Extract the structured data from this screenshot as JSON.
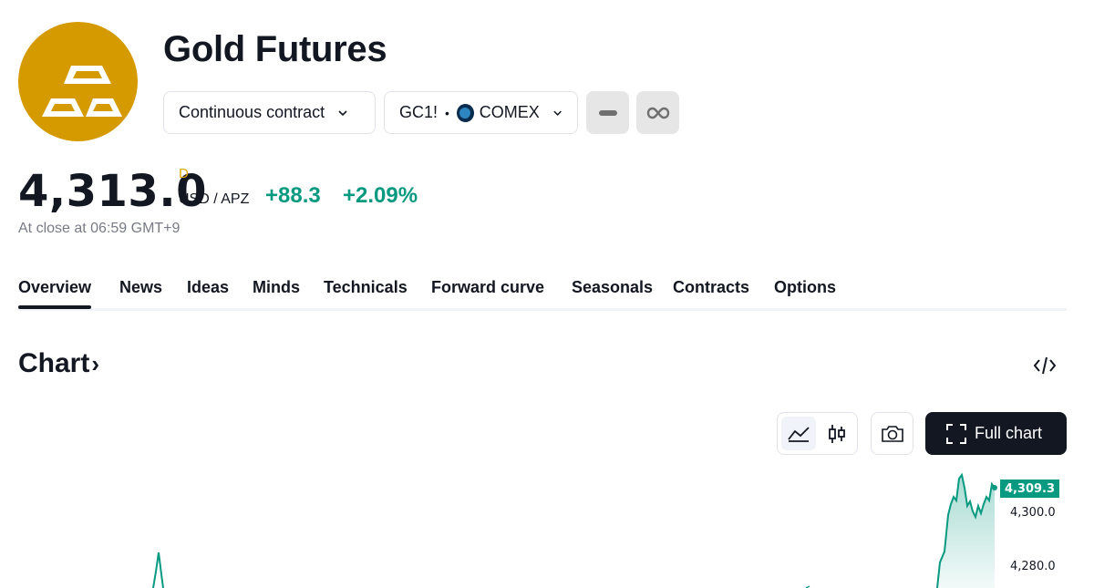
{
  "header": {
    "title": "Gold Futures",
    "contract_label": "Continuous contract",
    "symbol": "GC1!",
    "separator": "•",
    "exchange": "COMEX",
    "logo_icon": "gold-bars-icon",
    "brand_color": "#d49a00"
  },
  "quote": {
    "price": "4,313.0",
    "session_flag": "D",
    "currency": "USD / APZ",
    "change": "+88.3",
    "change_percent": "+2.09%",
    "close_time": "At close at 06:59 GMT+9",
    "positive_color": "#089981"
  },
  "tabs": [
    {
      "label": "Overview",
      "active": true
    },
    {
      "label": "News"
    },
    {
      "label": "Ideas"
    },
    {
      "label": "Minds"
    },
    {
      "label": "Technicals"
    },
    {
      "label": "Forward curve"
    },
    {
      "label": "Seasonals"
    },
    {
      "label": "Contracts"
    },
    {
      "label": "Options"
    }
  ],
  "chart_section": {
    "heading": "Chart",
    "heading_arrow": "›",
    "full_chart_label": "Full chart",
    "last_price_tag": "4,309.3",
    "axis_labels": [
      "4,300.0",
      "4,280.0"
    ]
  }
}
